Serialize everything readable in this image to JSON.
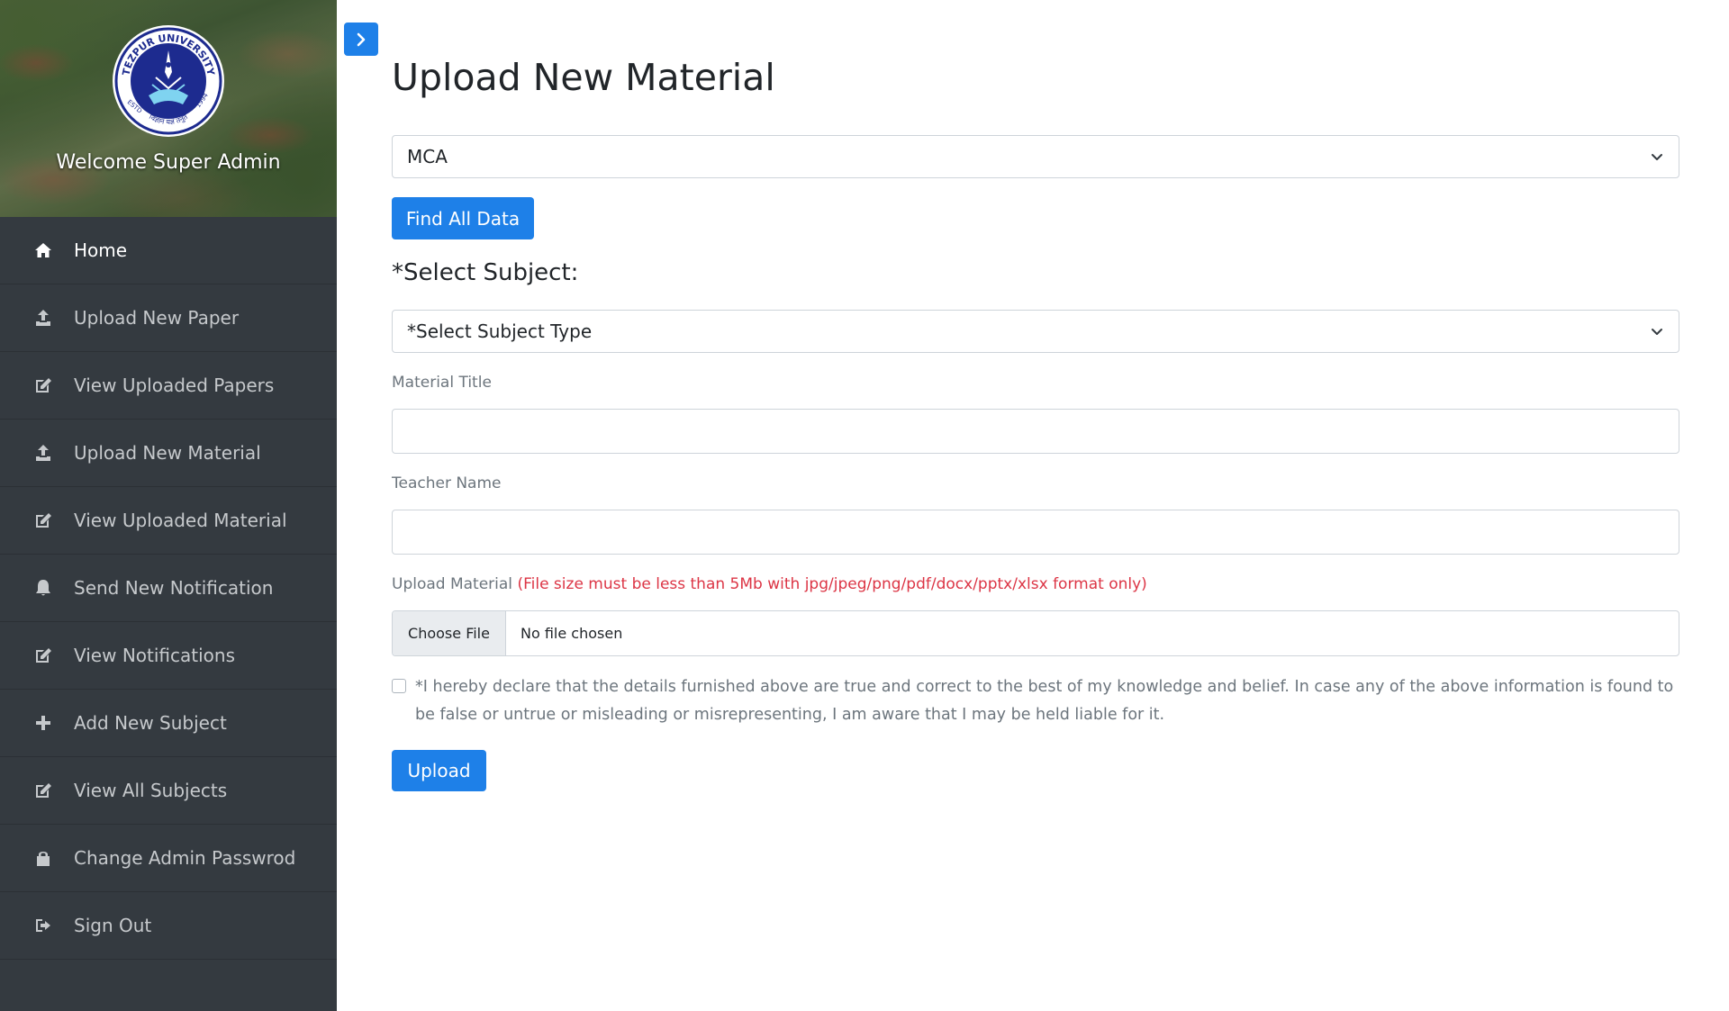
{
  "sidebar": {
    "welcome": "Welcome Super Admin",
    "logo": {
      "name": "tezpur-university-logo",
      "text_top": "TEZPUR UNIVERSITY",
      "text_bottom": "विज्ञान यज्ञं तनुते",
      "estd": "ESTD",
      "year": "1994"
    },
    "items": [
      {
        "label": "Home",
        "icon": "home-icon"
      },
      {
        "label": "Upload New Paper",
        "icon": "upload-icon"
      },
      {
        "label": "View Uploaded Papers",
        "icon": "edit-icon"
      },
      {
        "label": "Upload New Material",
        "icon": "upload-icon"
      },
      {
        "label": "View Uploaded Material",
        "icon": "edit-icon"
      },
      {
        "label": "Send New Notification",
        "icon": "bell-icon"
      },
      {
        "label": "View Notifications",
        "icon": "edit-icon"
      },
      {
        "label": "Add New Subject",
        "icon": "plus-icon"
      },
      {
        "label": "View All Subjects",
        "icon": "edit-icon"
      },
      {
        "label": "Change Admin Passwrod",
        "icon": "lock-icon"
      },
      {
        "label": "Sign Out",
        "icon": "sign-out-icon"
      }
    ]
  },
  "main": {
    "title": "Upload New Material",
    "course_select": {
      "value": "MCA"
    },
    "find_button": "Find All Data",
    "subject_heading": "*Select Subject:",
    "subject_select": {
      "value": "*Select Subject Type"
    },
    "material_title_label": "Material Title",
    "material_title_value": "",
    "teacher_name_label": "Teacher Name",
    "teacher_name_value": "",
    "upload_label": "Upload Material",
    "upload_warning": "(File size must be less than 5Mb with jpg/jpeg/png/pdf/docx/pptx/xlsx format only)",
    "choose_file": "Choose File",
    "no_file": "No file chosen",
    "declaration": "*I hereby declare that the details furnished above are true and correct to the best of my knowledge and belief. In case any of the above information is found to be false or untrue or misleading or misrepresenting, I am aware that I may be held liable for it.",
    "upload_button": "Upload"
  },
  "colors": {
    "sidebar_bg": "#343a40",
    "primary": "#1e80e8",
    "warning_text": "#dc3545",
    "muted_text": "#6c757d"
  }
}
